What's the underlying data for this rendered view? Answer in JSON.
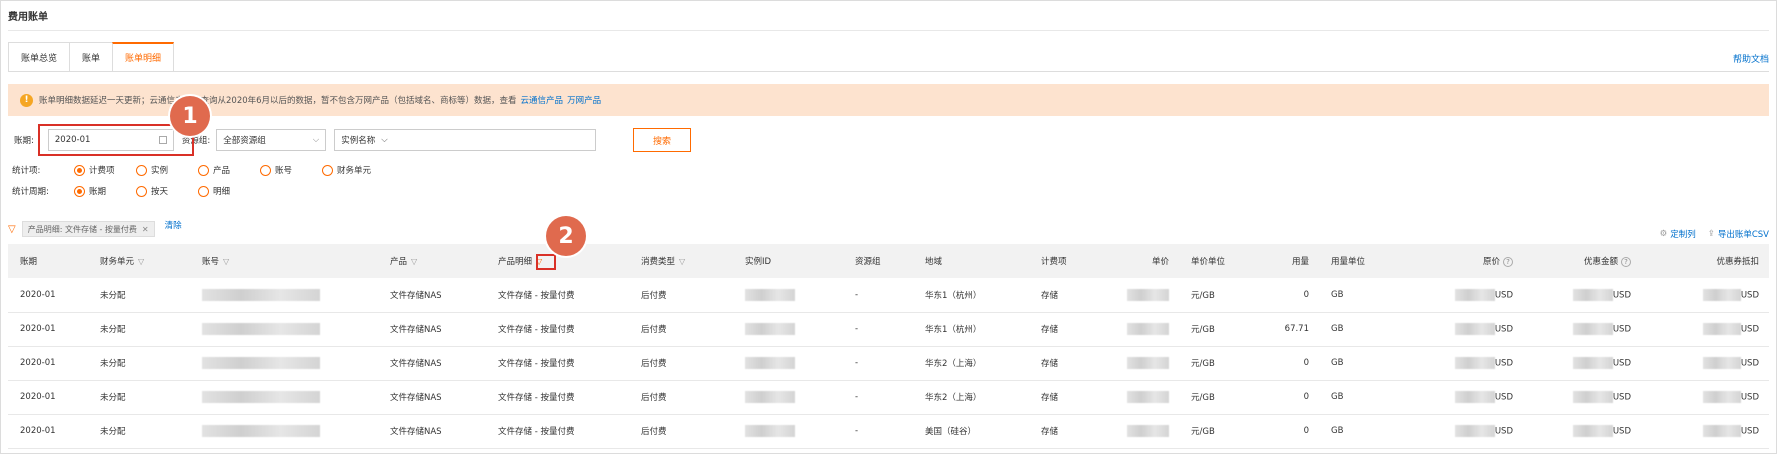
{
  "page_title": "费用账单",
  "tabs": [
    {
      "label": "账单总览",
      "active": false
    },
    {
      "label": "账单",
      "active": false
    },
    {
      "label": "账单明细",
      "active": true
    }
  ],
  "help_link": "帮助文档",
  "notice": {
    "text": "账单明细数据延迟一天更新；云通信产品可查询从2020年6月以后的数据，暂不包含万网产品（包括域名、商标等）数据，查看",
    "link1": "云通信产品",
    "link2": "万网产品"
  },
  "filters": {
    "period_label": "账期:",
    "period_value": "2020-01",
    "resource_group_label": "资源组:",
    "resource_group_value": "全部资源组",
    "instance_select": "实例名称",
    "search_button": "搜索",
    "stat_item_label": "统计项:",
    "stat_items": [
      {
        "label": "计费项",
        "selected": true
      },
      {
        "label": "实例",
        "selected": false
      },
      {
        "label": "产品",
        "selected": false
      },
      {
        "label": "账号",
        "selected": false
      },
      {
        "label": "财务单元",
        "selected": false
      }
    ],
    "stat_period_label": "统计周期:",
    "stat_periods": [
      {
        "label": "账期",
        "selected": true
      },
      {
        "label": "按天",
        "selected": false
      },
      {
        "label": "明细",
        "selected": false
      }
    ]
  },
  "active_filter": {
    "chip": "产品明细: 文件存储 - 按量付费",
    "clear": "清除"
  },
  "table_tools": {
    "customize": "定制列",
    "export": "导出账单CSV"
  },
  "badges": {
    "one": "1",
    "two": "2"
  },
  "table": {
    "headers": [
      "账期",
      "财务单元",
      "账号",
      "产品",
      "产品明细",
      "消费类型",
      "实例ID",
      "资源组",
      "地域",
      "计费项",
      "单价",
      "单价单位",
      "用量",
      "用量单位",
      "原价",
      "优惠金额",
      "优惠券抵扣"
    ],
    "rows": [
      [
        "2020-01",
        "未分配",
        "",
        "文件存储NAS",
        "文件存储 - 按量付费",
        "后付费",
        "",
        "-",
        "华东1（杭州）",
        "存储",
        "",
        "元/GB",
        "0",
        "GB",
        "USD",
        "USD",
        "USD"
      ],
      [
        "2020-01",
        "未分配",
        "",
        "文件存储NAS",
        "文件存储 - 按量付费",
        "后付费",
        "",
        "-",
        "华东1（杭州）",
        "存储",
        "",
        "元/GB",
        "67.71",
        "GB",
        "USD",
        "USD",
        "USD"
      ],
      [
        "2020-01",
        "未分配",
        "",
        "文件存储NAS",
        "文件存储 - 按量付费",
        "后付费",
        "",
        "-",
        "华东2（上海）",
        "存储",
        "",
        "元/GB",
        "0",
        "GB",
        "USD",
        "USD",
        "USD"
      ],
      [
        "2020-01",
        "未分配",
        "",
        "文件存储NAS",
        "文件存储 - 按量付费",
        "后付费",
        "",
        "-",
        "华东2（上海）",
        "存储",
        "",
        "元/GB",
        "0",
        "GB",
        "USD",
        "USD",
        "USD"
      ],
      [
        "2020-01",
        "未分配",
        "",
        "文件存储NAS",
        "文件存储 - 按量付费",
        "后付费",
        "",
        "-",
        "美国（硅谷）",
        "存储",
        "",
        "元/GB",
        "0",
        "GB",
        "USD",
        "USD",
        "USD"
      ]
    ]
  },
  "colors": {
    "accent": "#ff6a00",
    "link": "#0070cc",
    "notice_bg": "#fde3cf",
    "badge": "#e06a4e",
    "highlight": "#d93026"
  }
}
